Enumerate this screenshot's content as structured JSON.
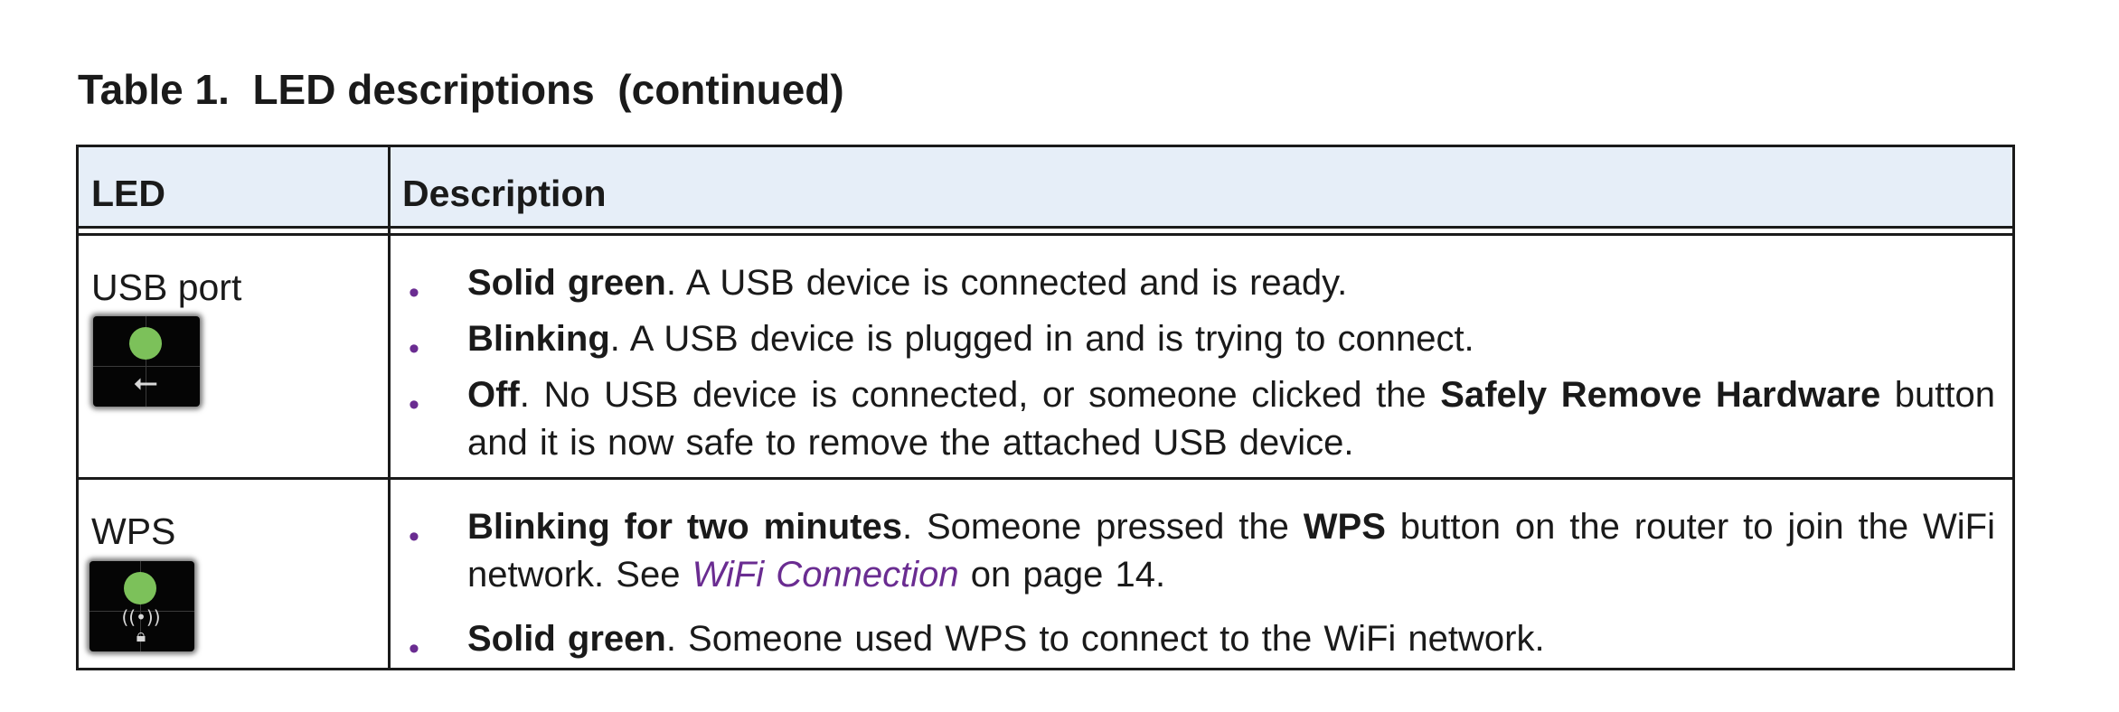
{
  "caption": {
    "prefix": "Table 1.",
    "title": "LED descriptions",
    "suffix": "(continued)"
  },
  "table": {
    "headers": {
      "led": "LED",
      "description": "Description"
    },
    "rows": [
      {
        "led_name": "USB port",
        "icon": "usb-icon",
        "led_color": "#7cc15a",
        "bullets": [
          {
            "lead": "Solid green",
            "text": ". A USB device is connected and is ready."
          },
          {
            "lead": "Blinking",
            "text": ". A USB device is plugged in and is trying to connect."
          },
          {
            "lead": "Off",
            "text_a": ". No USB device is connected, or someone clicked the ",
            "bold_b": "Safely Remove Hardware",
            "text_c": " button and it is now safe to remove the attached USB device."
          }
        ]
      },
      {
        "led_name": "WPS",
        "icon": "wps-lock-icon",
        "led_color": "#7cc15a",
        "bullets": [
          {
            "lead": "Blinking for two minutes",
            "text_a": ". Someone pressed the ",
            "bold_b": "WPS",
            "text_c": " button on the router to join the WiFi network. See ",
            "link": "WiFi Connection",
            "text_d": " on page 14."
          },
          {
            "lead": "Solid green",
            "text": ". Someone used WPS to connect to the WiFi network."
          }
        ]
      }
    ]
  },
  "colors": {
    "header_bg": "#e6eef8",
    "bullet": "#6a2c91",
    "link": "#6a2c91",
    "led_green": "#7cc15a"
  }
}
